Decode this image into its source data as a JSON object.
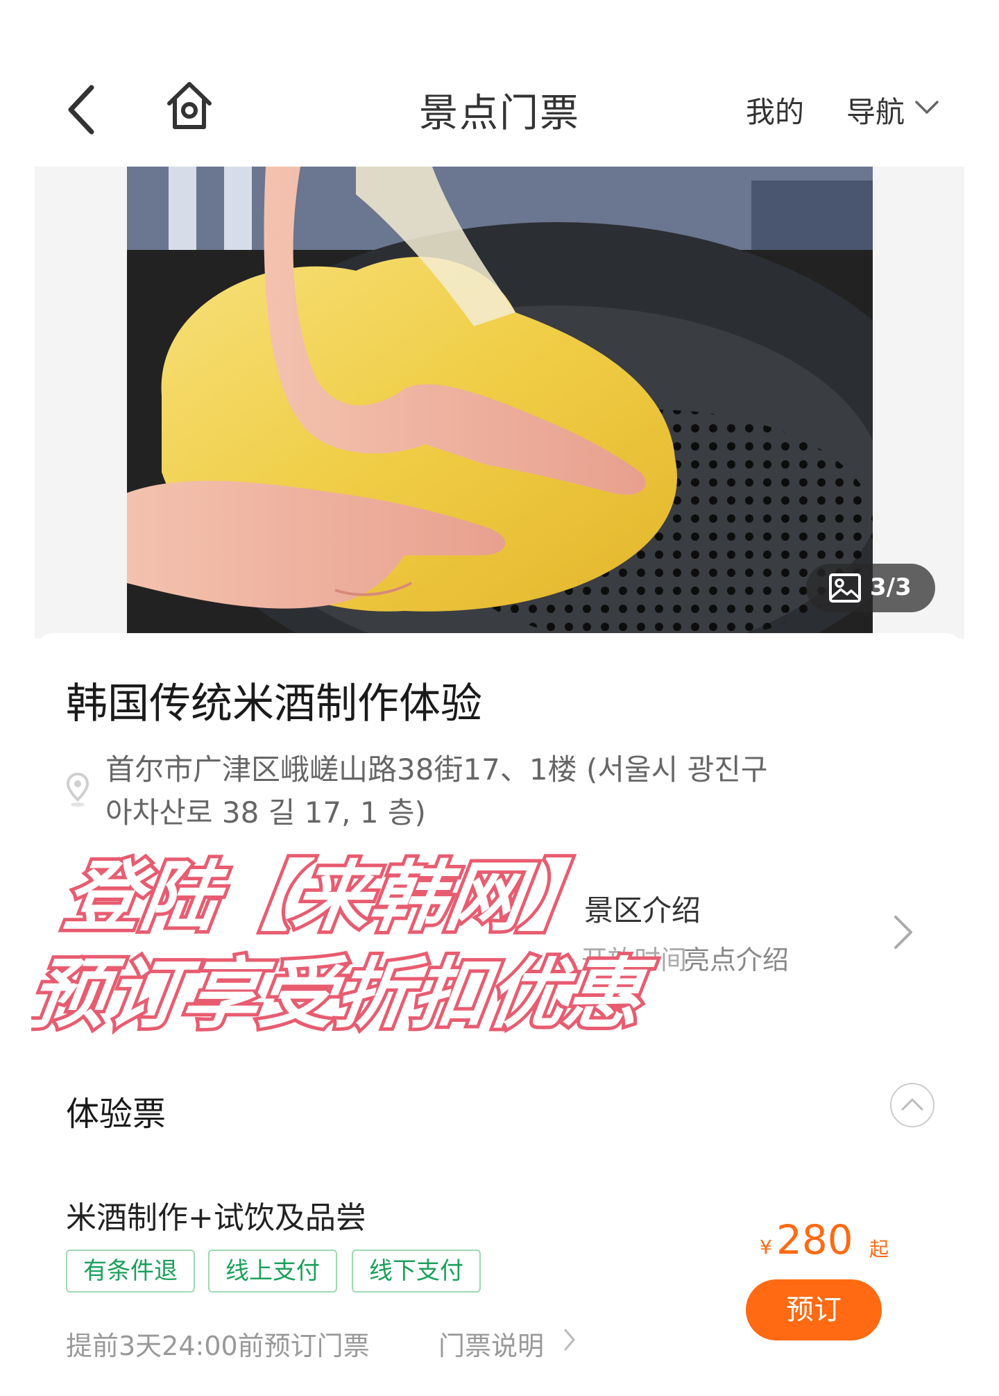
{
  "header": {
    "title": "景点门票",
    "mine_label": "我的",
    "nav_label": "导航",
    "icons": {
      "back": "chevron-left-icon",
      "home": "home-icon",
      "nav": "chevron-down-icon"
    }
  },
  "gallery": {
    "counter": "3/3",
    "counter_icon": "image-icon"
  },
  "attraction": {
    "title": "韩国传统米酒制作体验",
    "address_line_1": "首尔市广津区峨嵯山路38街17、1楼 (서울시 광진구",
    "address_line_2": "아차산로 38 길 17, 1 층)",
    "pin_icon": "location-pin-icon"
  },
  "intro": {
    "title": "景区介绍",
    "opening_hours": "开放时间",
    "highlights": "亮点介绍",
    "arrow_icon": "chevron-right-icon"
  },
  "promo": {
    "line_1": "登陆【来韩网】",
    "line_2": "预订享受折扣优惠"
  },
  "tickets": {
    "section_title": "体验票",
    "collapse_icon": "chevron-up-icon",
    "items": [
      {
        "name": "米酒制作+试饮及品尝",
        "tags": [
          "有条件退",
          "线上支付",
          "线下支付"
        ],
        "price_currency": "¥",
        "price": "280",
        "price_suffix": "起",
        "book_label": "预订",
        "deadline": "提前3天24:00前预订门票",
        "info_label": "门票说明"
      }
    ]
  },
  "colors": {
    "accent": "#ff6a13",
    "tag_green": "#1aa05a",
    "promo_fill": "#ffffff",
    "promo_outline": "#e85c70"
  }
}
